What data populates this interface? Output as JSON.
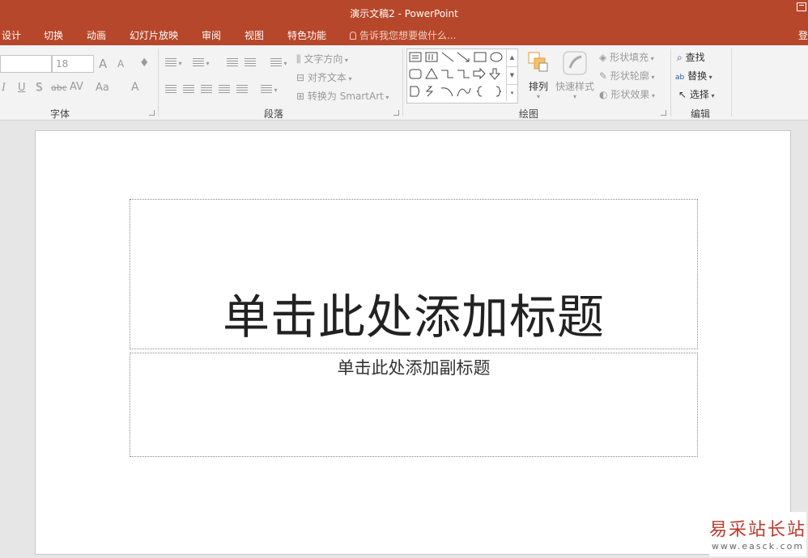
{
  "window": {
    "title": "演示文稿2 - PowerPoint"
  },
  "tabs": [
    "设计",
    "切换",
    "动画",
    "幻灯片放映",
    "审阅",
    "视图",
    "特色功能"
  ],
  "tell_me": "告诉我您想要做什么...",
  "user_cut": "登",
  "ribbon": {
    "font": {
      "label": "字体",
      "size": "18",
      "grow": "A",
      "shrink": "A",
      "italic": "I",
      "underline": "U",
      "shadow": "S",
      "strike": "abc",
      "spacing": "AV",
      "case": "Aa",
      "color": "A"
    },
    "paragraph": {
      "label": "段落",
      "text_direction": "文字方向",
      "align_text": "对齐文本",
      "smartart": "转换为 SmartArt"
    },
    "drawing": {
      "label": "绘图",
      "arrange": "排列",
      "quick_styles": "快速样式",
      "shape_fill": "形状填充",
      "shape_outline": "形状轮廓",
      "shape_effects": "形状效果"
    },
    "editing": {
      "label": "编辑",
      "find": "查找",
      "replace": "替换",
      "select": "选择"
    }
  },
  "slide": {
    "title_placeholder": "单击此处添加标题",
    "subtitle_placeholder": "单击此处添加副标题"
  },
  "watermark": {
    "chinese": "易采站长站",
    "url": "www.easck.com"
  }
}
